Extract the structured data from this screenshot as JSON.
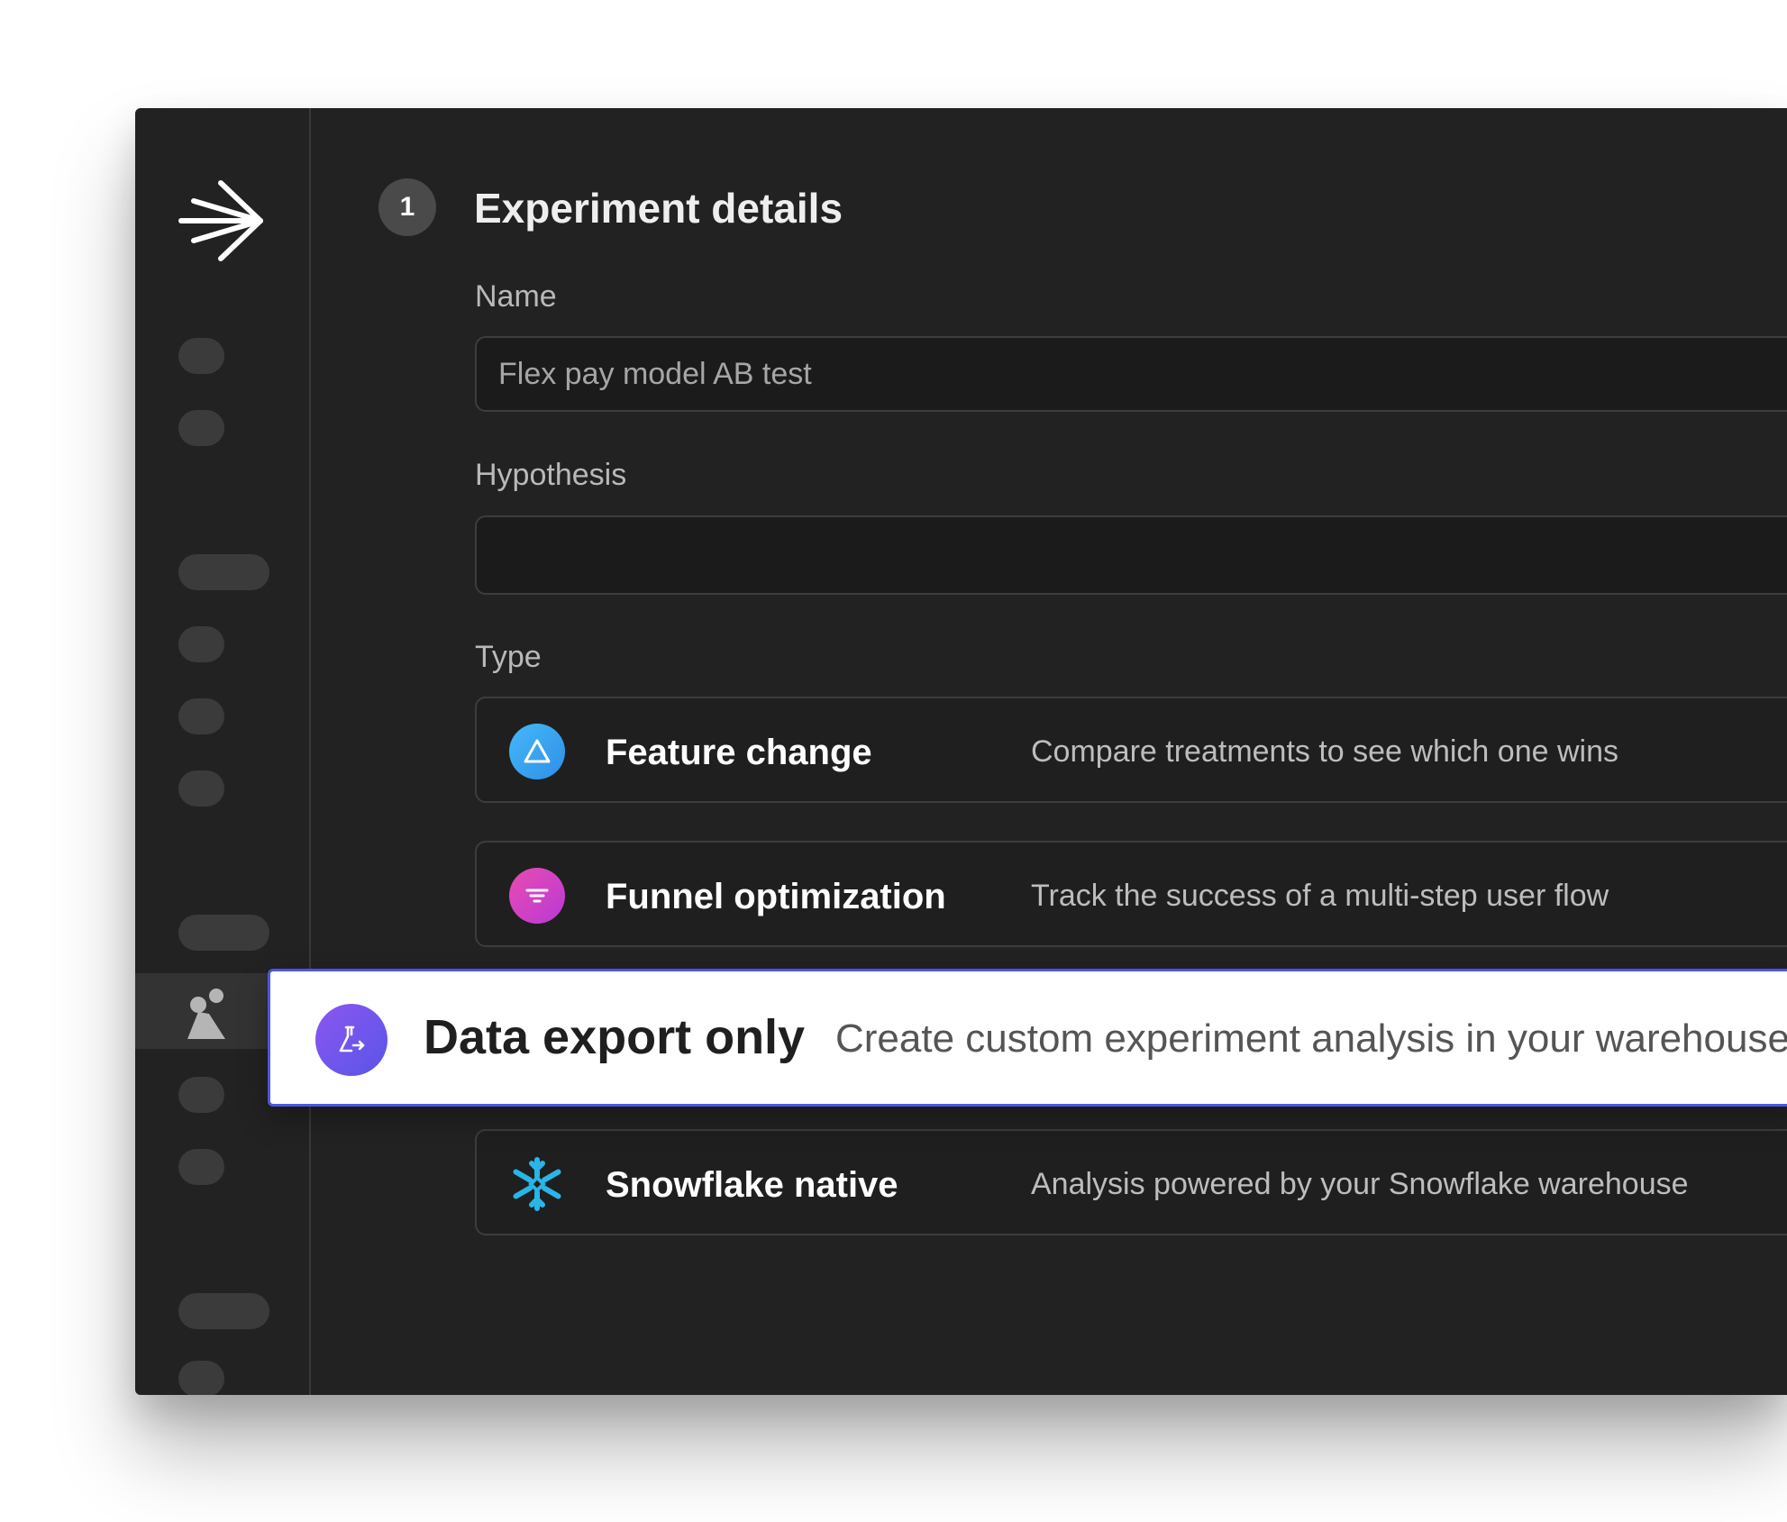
{
  "step": {
    "number": "1",
    "title": "Experiment details"
  },
  "form": {
    "name_label": "Name",
    "name_value": "Flex pay model AB test",
    "hypothesis_label": "Hypothesis",
    "hypothesis_value": "",
    "type_label": "Type"
  },
  "types": [
    {
      "title": "Feature change",
      "description": "Compare treatments to see which one wins",
      "icon": "triangle-icon",
      "color": "#3aa6f0"
    },
    {
      "title": "Funnel optimization",
      "description": "Track the success of a multi-step user flow",
      "icon": "funnel-icon",
      "color": "#d63fc0"
    },
    {
      "title": "Data export only",
      "description": "Create custom experiment analysis in your warehouse",
      "icon": "flask-export-icon",
      "color": "#6d55ec",
      "selected": true
    },
    {
      "title": "Snowflake native",
      "description": "Analysis powered by your Snowflake warehouse",
      "icon": "snowflake-icon",
      "color": "#29b5e8"
    }
  ],
  "colors": {
    "selection_border": "#4b57e0",
    "window_bg": "#222222"
  }
}
